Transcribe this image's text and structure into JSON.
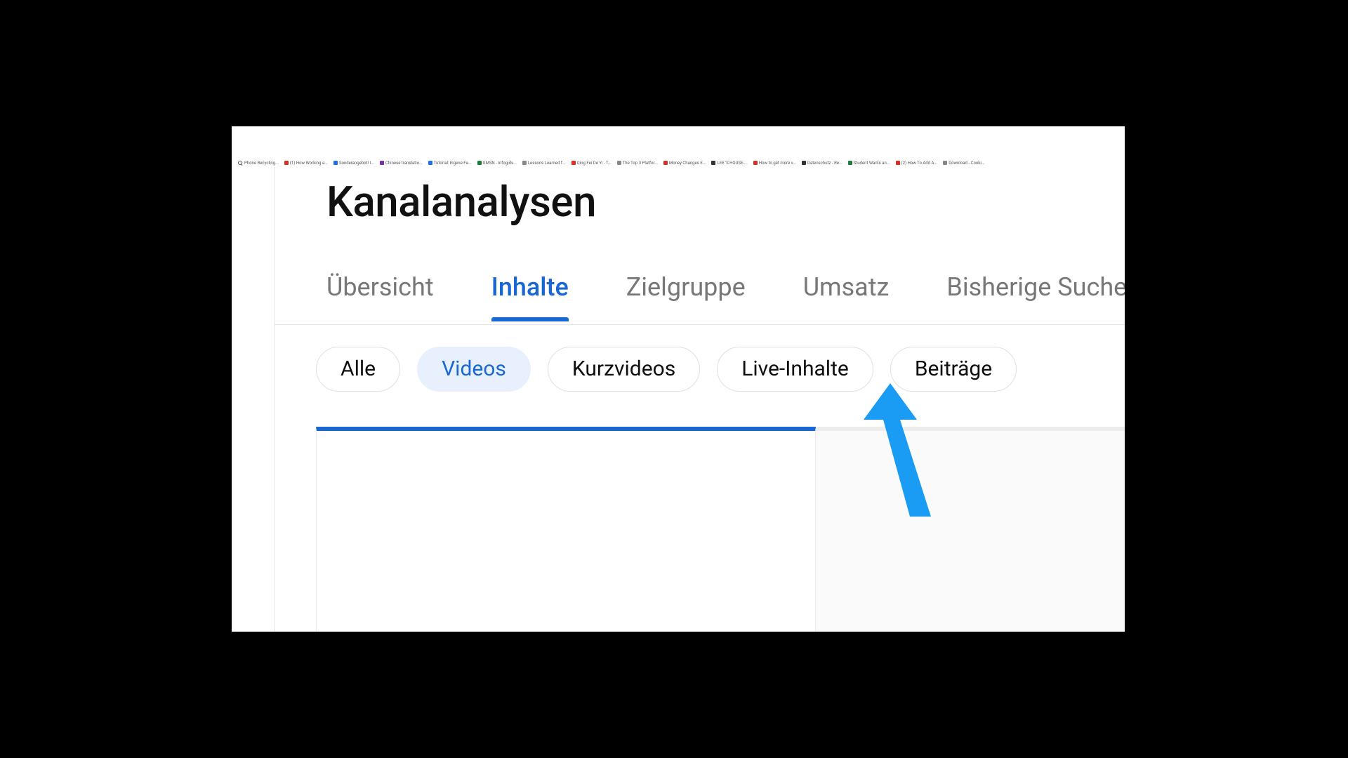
{
  "colors": {
    "accent": "#1967d2",
    "chip_active_bg": "#e8f0fe",
    "arrow": "#1a9bf4"
  },
  "browser_tabs": [
    {
      "icon": "search",
      "label": "Phone Recycling..."
    },
    {
      "icon": "red",
      "label": "(1) How Working a..."
    },
    {
      "icon": "blu",
      "label": "Sonderangebot! I..."
    },
    {
      "icon": "pur",
      "label": "Chinese translatio..."
    },
    {
      "icon": "blu",
      "label": "Tutorial: Eigene Fa..."
    },
    {
      "icon": "grn",
      "label": "GMSN - Infogids..."
    },
    {
      "icon": "gry",
      "label": "Lessons Learned f..."
    },
    {
      "icon": "red",
      "label": "Qing Fei De Yi - T..."
    },
    {
      "icon": "gry",
      "label": "The Top 3 Platfor..."
    },
    {
      "icon": "red",
      "label": "Money Changes E..."
    },
    {
      "icon": "drk",
      "label": "LEE 'S HOUSE-..."
    },
    {
      "icon": "red",
      "label": "How to get more v..."
    },
    {
      "icon": "drk",
      "label": "Datenschutz - Re..."
    },
    {
      "icon": "grn",
      "label": "Student Wants an..."
    },
    {
      "icon": "red",
      "label": "(2) How To Add A..."
    },
    {
      "icon": "gry",
      "label": "Download - Cooki..."
    }
  ],
  "page": {
    "title": "Kanalanalysen"
  },
  "tabs": [
    {
      "id": "overview",
      "label": "Übersicht",
      "active": false
    },
    {
      "id": "content",
      "label": "Inhalte",
      "active": true
    },
    {
      "id": "audience",
      "label": "Zielgruppe",
      "active": false
    },
    {
      "id": "revenue",
      "label": "Umsatz",
      "active": false
    },
    {
      "id": "research",
      "label": "Bisherige Suchen",
      "active": false
    }
  ],
  "chips": [
    {
      "id": "all",
      "label": "Alle",
      "active": false
    },
    {
      "id": "videos",
      "label": "Videos",
      "active": true
    },
    {
      "id": "shorts",
      "label": "Kurzvideos",
      "active": false
    },
    {
      "id": "live",
      "label": "Live-Inhalte",
      "active": false
    },
    {
      "id": "posts",
      "label": "Beiträge",
      "active": false
    }
  ]
}
